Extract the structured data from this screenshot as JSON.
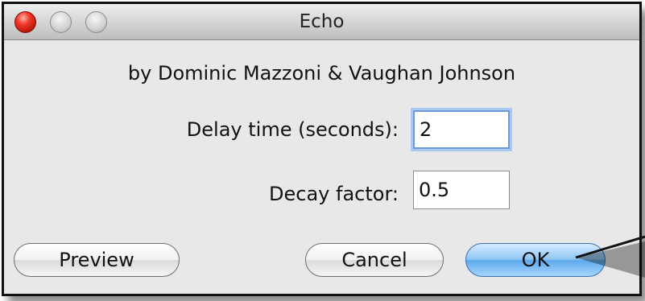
{
  "window": {
    "title": "Echo",
    "controls": {
      "close_icon": "close-button-icon",
      "minimize_icon": "minimize-button-icon",
      "zoom_icon": "zoom-button-icon"
    }
  },
  "dialog": {
    "credits": "by Dominic Mazzoni & Vaughan Johnson",
    "delay_label": "Delay time (seconds):",
    "delay_value": "2",
    "decay_label": "Decay factor:",
    "decay_value": "0.5"
  },
  "buttons": {
    "preview_label": "Preview",
    "cancel_label": "Cancel",
    "ok_label": "OK"
  },
  "colors": {
    "close_red": "#f0382a",
    "default_button_blue": "#5da9ea",
    "focus_ring": "#a9c9f3"
  }
}
